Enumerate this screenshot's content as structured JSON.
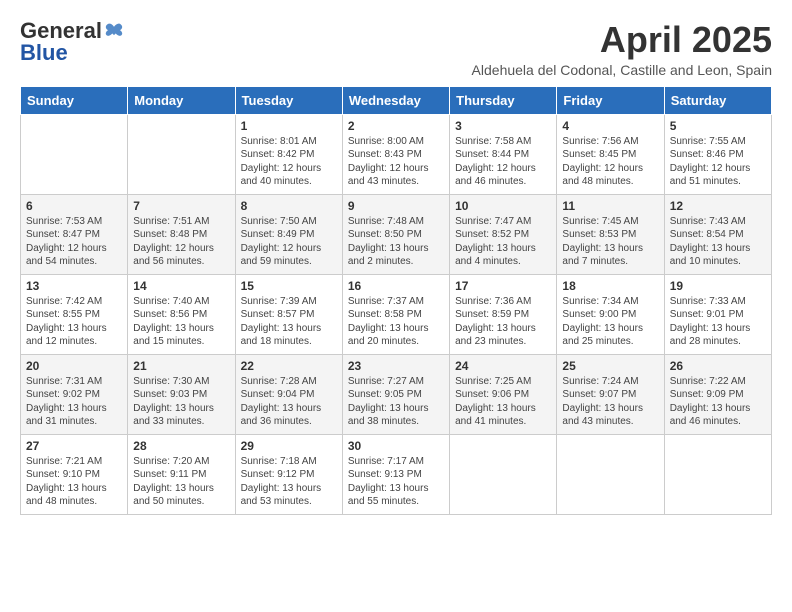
{
  "header": {
    "logo_general": "General",
    "logo_blue": "Blue",
    "title": "April 2025",
    "subtitle": "Aldehuela del Codonal, Castille and Leon, Spain"
  },
  "weekdays": [
    "Sunday",
    "Monday",
    "Tuesday",
    "Wednesday",
    "Thursday",
    "Friday",
    "Saturday"
  ],
  "weeks": [
    [
      {
        "day": "",
        "info": ""
      },
      {
        "day": "",
        "info": ""
      },
      {
        "day": "1",
        "info": "Sunrise: 8:01 AM\nSunset: 8:42 PM\nDaylight: 12 hours and 40 minutes."
      },
      {
        "day": "2",
        "info": "Sunrise: 8:00 AM\nSunset: 8:43 PM\nDaylight: 12 hours and 43 minutes."
      },
      {
        "day": "3",
        "info": "Sunrise: 7:58 AM\nSunset: 8:44 PM\nDaylight: 12 hours and 46 minutes."
      },
      {
        "day": "4",
        "info": "Sunrise: 7:56 AM\nSunset: 8:45 PM\nDaylight: 12 hours and 48 minutes."
      },
      {
        "day": "5",
        "info": "Sunrise: 7:55 AM\nSunset: 8:46 PM\nDaylight: 12 hours and 51 minutes."
      }
    ],
    [
      {
        "day": "6",
        "info": "Sunrise: 7:53 AM\nSunset: 8:47 PM\nDaylight: 12 hours and 54 minutes."
      },
      {
        "day": "7",
        "info": "Sunrise: 7:51 AM\nSunset: 8:48 PM\nDaylight: 12 hours and 56 minutes."
      },
      {
        "day": "8",
        "info": "Sunrise: 7:50 AM\nSunset: 8:49 PM\nDaylight: 12 hours and 59 minutes."
      },
      {
        "day": "9",
        "info": "Sunrise: 7:48 AM\nSunset: 8:50 PM\nDaylight: 13 hours and 2 minutes."
      },
      {
        "day": "10",
        "info": "Sunrise: 7:47 AM\nSunset: 8:52 PM\nDaylight: 13 hours and 4 minutes."
      },
      {
        "day": "11",
        "info": "Sunrise: 7:45 AM\nSunset: 8:53 PM\nDaylight: 13 hours and 7 minutes."
      },
      {
        "day": "12",
        "info": "Sunrise: 7:43 AM\nSunset: 8:54 PM\nDaylight: 13 hours and 10 minutes."
      }
    ],
    [
      {
        "day": "13",
        "info": "Sunrise: 7:42 AM\nSunset: 8:55 PM\nDaylight: 13 hours and 12 minutes."
      },
      {
        "day": "14",
        "info": "Sunrise: 7:40 AM\nSunset: 8:56 PM\nDaylight: 13 hours and 15 minutes."
      },
      {
        "day": "15",
        "info": "Sunrise: 7:39 AM\nSunset: 8:57 PM\nDaylight: 13 hours and 18 minutes."
      },
      {
        "day": "16",
        "info": "Sunrise: 7:37 AM\nSunset: 8:58 PM\nDaylight: 13 hours and 20 minutes."
      },
      {
        "day": "17",
        "info": "Sunrise: 7:36 AM\nSunset: 8:59 PM\nDaylight: 13 hours and 23 minutes."
      },
      {
        "day": "18",
        "info": "Sunrise: 7:34 AM\nSunset: 9:00 PM\nDaylight: 13 hours and 25 minutes."
      },
      {
        "day": "19",
        "info": "Sunrise: 7:33 AM\nSunset: 9:01 PM\nDaylight: 13 hours and 28 minutes."
      }
    ],
    [
      {
        "day": "20",
        "info": "Sunrise: 7:31 AM\nSunset: 9:02 PM\nDaylight: 13 hours and 31 minutes."
      },
      {
        "day": "21",
        "info": "Sunrise: 7:30 AM\nSunset: 9:03 PM\nDaylight: 13 hours and 33 minutes."
      },
      {
        "day": "22",
        "info": "Sunrise: 7:28 AM\nSunset: 9:04 PM\nDaylight: 13 hours and 36 minutes."
      },
      {
        "day": "23",
        "info": "Sunrise: 7:27 AM\nSunset: 9:05 PM\nDaylight: 13 hours and 38 minutes."
      },
      {
        "day": "24",
        "info": "Sunrise: 7:25 AM\nSunset: 9:06 PM\nDaylight: 13 hours and 41 minutes."
      },
      {
        "day": "25",
        "info": "Sunrise: 7:24 AM\nSunset: 9:07 PM\nDaylight: 13 hours and 43 minutes."
      },
      {
        "day": "26",
        "info": "Sunrise: 7:22 AM\nSunset: 9:09 PM\nDaylight: 13 hours and 46 minutes."
      }
    ],
    [
      {
        "day": "27",
        "info": "Sunrise: 7:21 AM\nSunset: 9:10 PM\nDaylight: 13 hours and 48 minutes."
      },
      {
        "day": "28",
        "info": "Sunrise: 7:20 AM\nSunset: 9:11 PM\nDaylight: 13 hours and 50 minutes."
      },
      {
        "day": "29",
        "info": "Sunrise: 7:18 AM\nSunset: 9:12 PM\nDaylight: 13 hours and 53 minutes."
      },
      {
        "day": "30",
        "info": "Sunrise: 7:17 AM\nSunset: 9:13 PM\nDaylight: 13 hours and 55 minutes."
      },
      {
        "day": "",
        "info": ""
      },
      {
        "day": "",
        "info": ""
      },
      {
        "day": "",
        "info": ""
      }
    ]
  ]
}
